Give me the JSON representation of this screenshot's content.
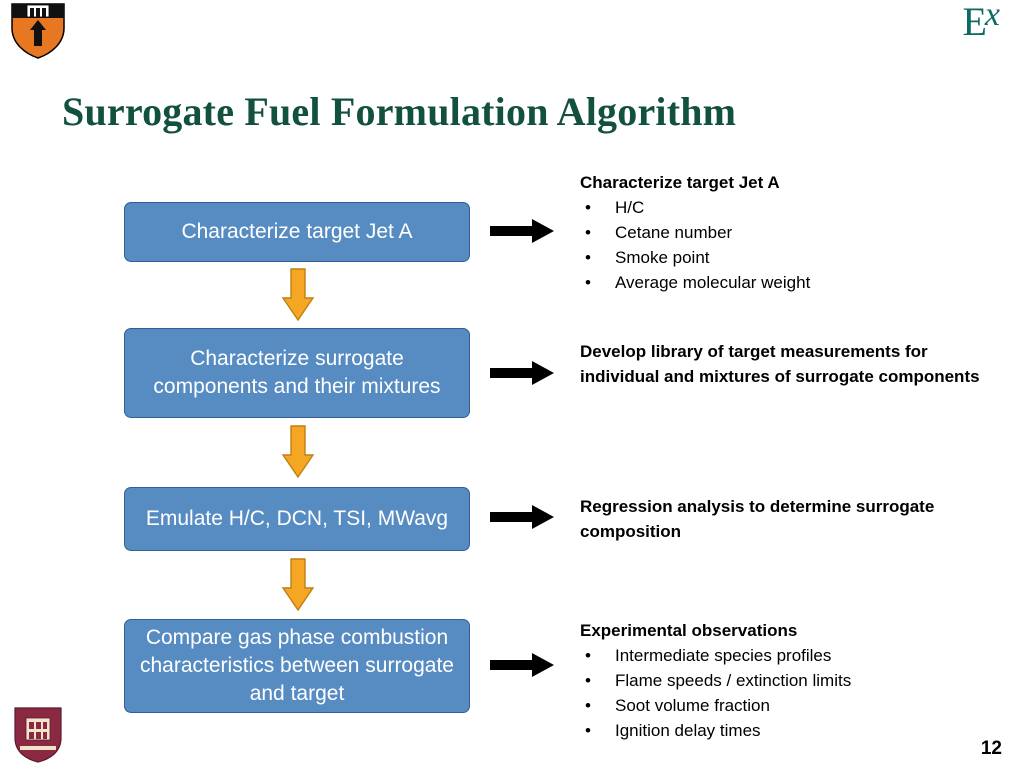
{
  "slide": {
    "title": "Surrogate Fuel Formulation Algorithm",
    "page_number": "12",
    "logo": {
      "e": "E",
      "x": "x",
      "color": "#0d6b63"
    },
    "shield_alt": "princeton-shield",
    "crest_alt": "university-crest"
  },
  "flow": {
    "accent_box_color": "#578cc3",
    "arrow_color": "#f5a623",
    "boxes": [
      {
        "label": "Characterize target Jet A"
      },
      {
        "label": "Characterize surrogate components and their mixtures"
      },
      {
        "label": "Emulate H/C, DCN, TSI, MWavg"
      },
      {
        "label": "Compare gas phase combustion characteristics between surrogate and target"
      }
    ]
  },
  "annotations": [
    {
      "head": "Characterize target Jet A",
      "items": [
        "H/C",
        "Cetane number",
        "Smoke point",
        "Average molecular weight"
      ]
    },
    {
      "head": "Develop library of target measurements for individual and mixtures of surrogate components",
      "items": []
    },
    {
      "head": "Regression analysis to determine surrogate composition",
      "items": []
    },
    {
      "head": "Experimental observations",
      "items": [
        "Intermediate species profiles",
        "Flame speeds / extinction limits",
        "Soot volume fraction",
        "Ignition delay times"
      ]
    }
  ]
}
